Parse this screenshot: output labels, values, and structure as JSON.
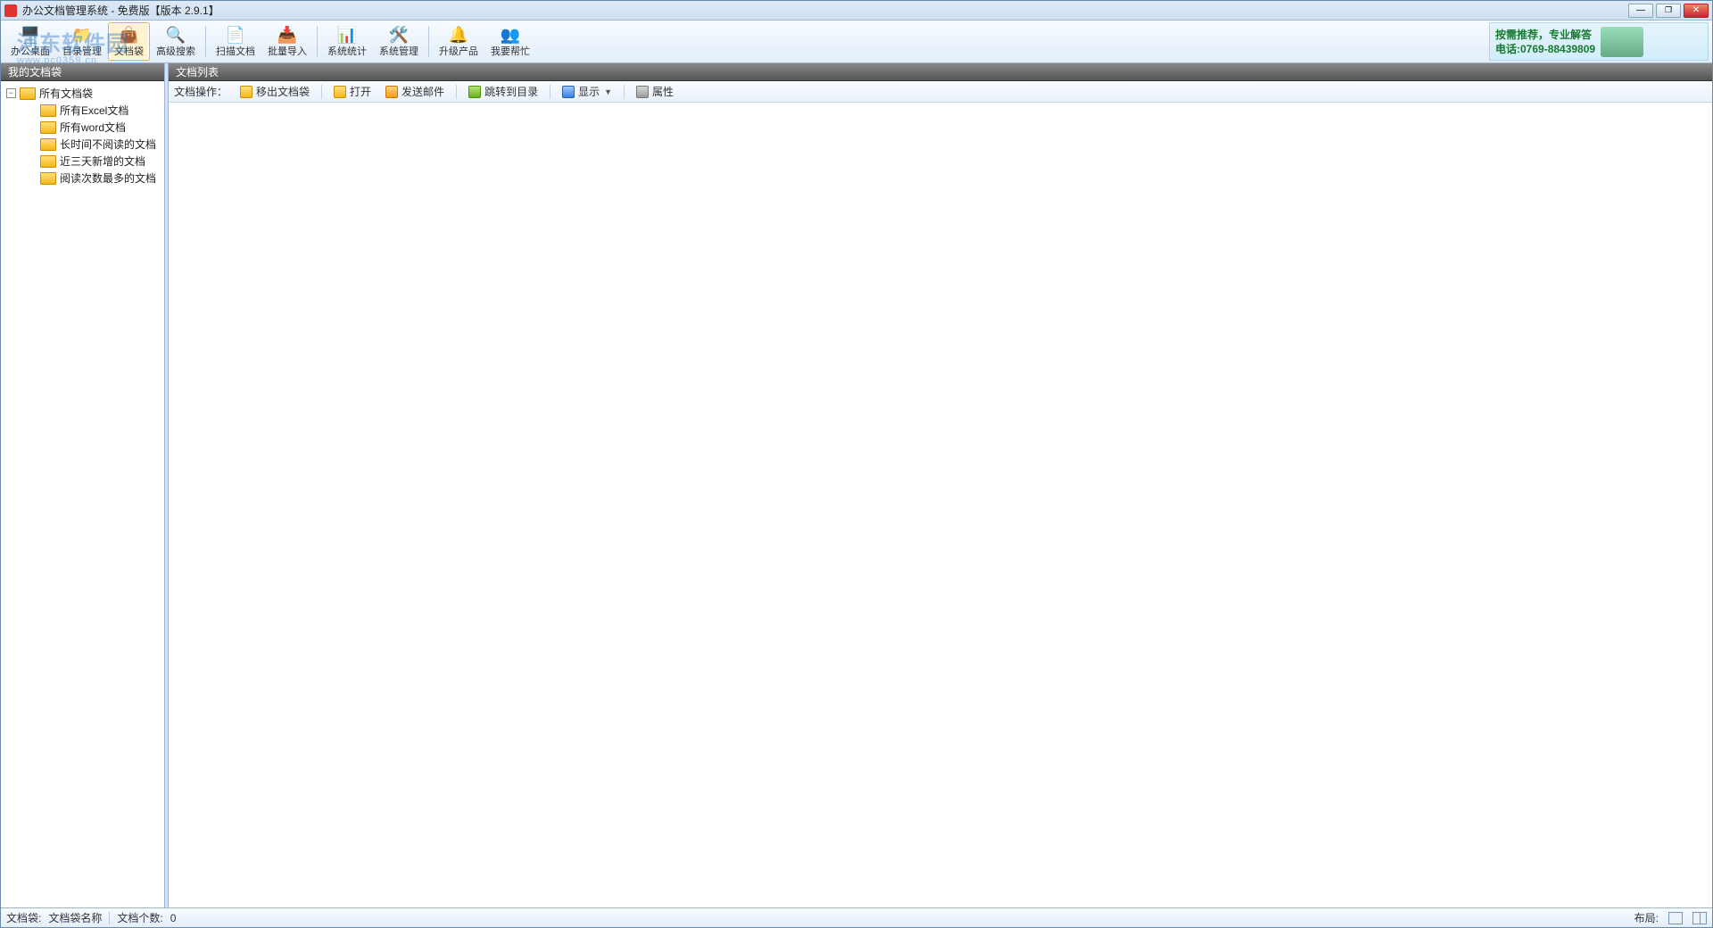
{
  "title": "办公文档管理系统  -  免费版【版本 2.9.1】",
  "watermark": {
    "brand": "河东软件园",
    "url": "www.pc0359.cn"
  },
  "toolbar": {
    "items": [
      {
        "label": "办公桌面",
        "icon": "🖥️"
      },
      {
        "label": "目录管理",
        "icon": "📁"
      },
      {
        "label": "文档袋",
        "icon": "👜",
        "active": true
      },
      {
        "label": "高级搜索",
        "icon": "🔍"
      }
    ],
    "items2": [
      {
        "label": "扫描文档",
        "icon": "📄"
      },
      {
        "label": "批量导入",
        "icon": "📥"
      }
    ],
    "items3": [
      {
        "label": "系统统计",
        "icon": "📊"
      },
      {
        "label": "系统管理",
        "icon": "🛠️"
      }
    ],
    "items4": [
      {
        "label": "升级产品",
        "icon": "🔔"
      },
      {
        "label": "我要帮忙",
        "icon": "👥"
      }
    ]
  },
  "brand": {
    "line1": "按需推荐，专业解答",
    "line2": "电话:0769-88439809"
  },
  "sidebar": {
    "title": "我的文档袋",
    "root": "所有文档袋",
    "children": [
      "所有Excel文档",
      "所有word文档",
      "长时间不阅读的文档",
      "近三天新增的文档",
      "阅读次数最多的文档"
    ]
  },
  "main": {
    "title": "文档列表",
    "ops_label": "文档操作：",
    "ops": {
      "move": "移出文档袋",
      "open": "打开",
      "mail": "发送邮件",
      "jump": "跳转到目录",
      "view": "显示",
      "prop": "属性"
    }
  },
  "status": {
    "bag_label": "文档袋:",
    "bag_value": "文档袋名称",
    "count_label": "文档个数:",
    "count_value": "0",
    "layout_label": "布局:"
  }
}
